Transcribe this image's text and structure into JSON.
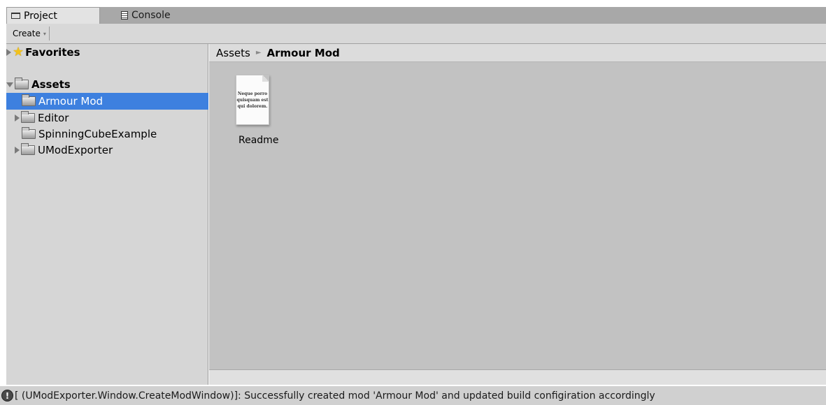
{
  "tabs": [
    {
      "label": "Project",
      "icon": "folder-icon",
      "active": true
    },
    {
      "label": "Console",
      "icon": "console-icon",
      "active": false
    }
  ],
  "toolbar": {
    "create_label": "Create",
    "create_arrow": "▾"
  },
  "tree": {
    "favorites": {
      "label": "Favorites",
      "icon": "star-icon"
    },
    "assets": {
      "label": "Assets"
    },
    "items": [
      {
        "label": "Armour Mod",
        "selected": true,
        "expandable": false
      },
      {
        "label": "Editor",
        "selected": false,
        "expandable": true
      },
      {
        "label": "SpinningCubeExample",
        "selected": false,
        "expandable": false
      },
      {
        "label": "UModExporter",
        "selected": false,
        "expandable": true
      }
    ]
  },
  "breadcrumb": {
    "root": "Assets",
    "separator": "►",
    "current": "Armour Mod"
  },
  "content": {
    "assets": [
      {
        "name": "Readme",
        "icon": "text-document-icon",
        "preview_lines": [
          "Neque porro",
          "quisquam est",
          "qui dolorem."
        ]
      }
    ]
  },
  "status": {
    "icon": "info-icon",
    "icon_glyph": "!",
    "message": "[ (UModExporter.Window.CreateModWindow)]: Successfully created mod 'Armour Mod'  and updated build configiration accordingly"
  },
  "colors": {
    "selection": "#3d80df",
    "content_bg": "#c2c2c2",
    "panel_bg": "#d6d6d6"
  }
}
